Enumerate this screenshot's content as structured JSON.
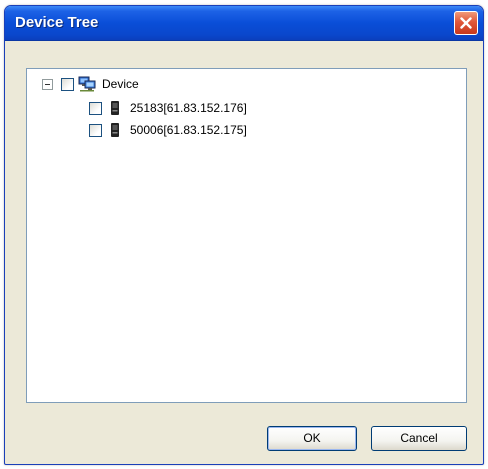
{
  "window": {
    "title": "Device Tree",
    "close_icon": "close-icon"
  },
  "tree": {
    "root": {
      "label": "Device",
      "expanded": true,
      "checked": false,
      "icon": "network-computers-icon"
    },
    "children": [
      {
        "label": "25183[61.83.152.176]",
        "checked": false,
        "icon": "device-icon"
      },
      {
        "label": "50006[61.83.152.175]",
        "checked": false,
        "icon": "device-icon"
      }
    ]
  },
  "buttons": {
    "ok_label": "OK",
    "cancel_label": "Cancel"
  },
  "colors": {
    "titlebar": "#0a4ed8",
    "close_button": "#e0573a",
    "dialog_face": "#ece9d8",
    "panel_border": "#7f9db9"
  }
}
